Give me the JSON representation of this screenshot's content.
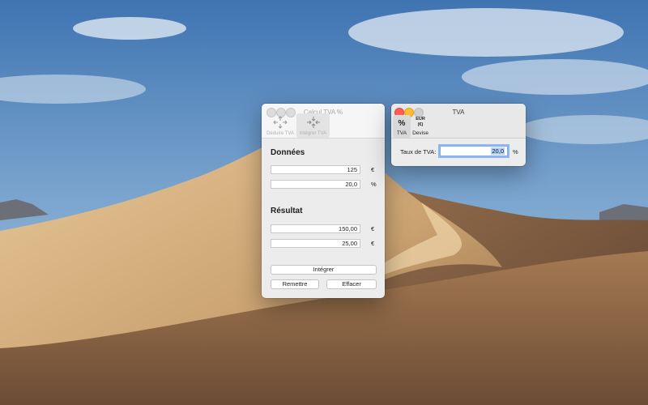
{
  "calc_window": {
    "title": "Calcul TVA %",
    "toolbar": [
      {
        "label": "Déduire TVA",
        "icon": "arrows-out-icon",
        "selected": false
      },
      {
        "label": "Intégrer TVA",
        "icon": "arrows-in-icon",
        "selected": true
      }
    ],
    "donnees": {
      "heading": "Données",
      "amount": "125",
      "amount_unit": "€",
      "rate": "20,0",
      "rate_unit": "%"
    },
    "resultat": {
      "heading": "Résultat",
      "total": "150,00",
      "total_unit": "€",
      "tax": "25,00",
      "tax_unit": "€"
    },
    "buttons": {
      "integrer": "Intégrer",
      "remettre": "Remettre",
      "effacer": "Effacer"
    }
  },
  "tva_window": {
    "title": "TVA",
    "toolbar": [
      {
        "label": "TVA",
        "icon_text": "%",
        "selected": true
      },
      {
        "label": "Devise",
        "icon_text_line1": "EUR",
        "icon_text_line2": "(€)",
        "selected": false
      }
    ],
    "rate_label": "Taux de TVA:",
    "rate_value": "20,0",
    "rate_unit": "%"
  },
  "colors": {
    "close": "#fe5f57",
    "minimize": "#febc2e",
    "zoom": "#28c840",
    "focus_ring": "#6ea6f0"
  }
}
